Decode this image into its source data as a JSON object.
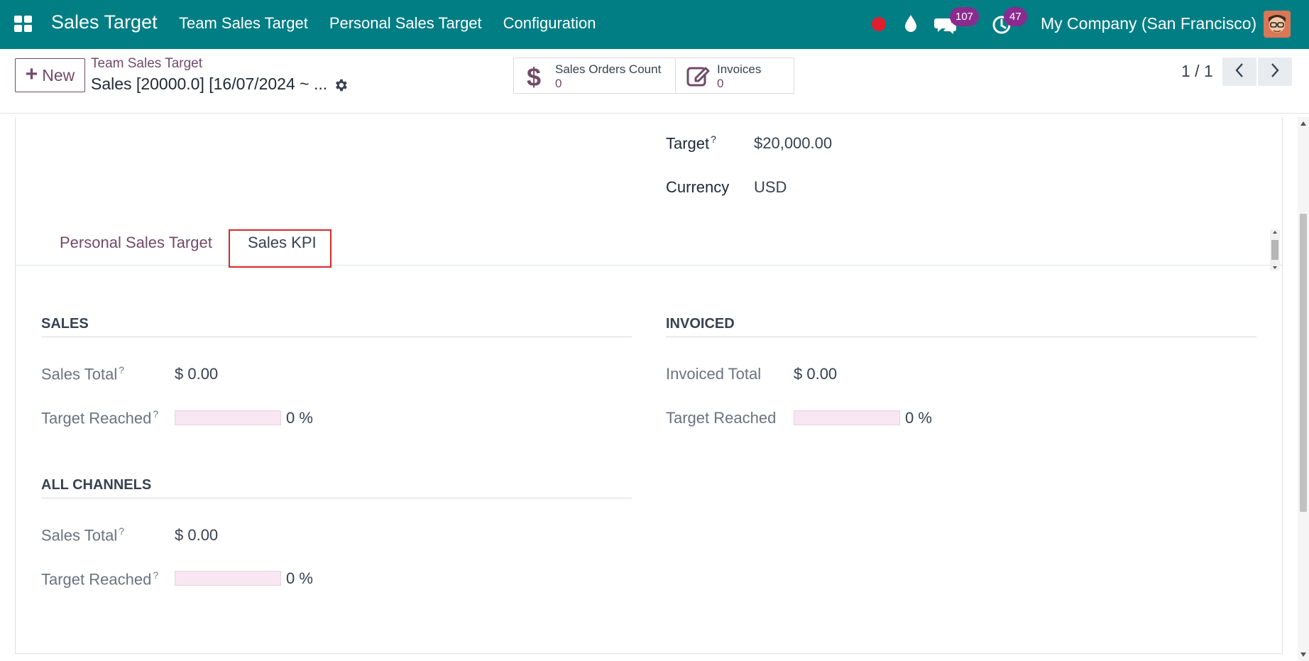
{
  "navbar": {
    "app_title": "Sales Target",
    "menu": [
      "Team Sales Target",
      "Personal Sales Target",
      "Configuration"
    ],
    "messages_badge": "107",
    "activities_badge": "47",
    "company": "My Company (San Francisco)"
  },
  "control_panel": {
    "new_label": "New",
    "breadcrumb": "Team Sales Target",
    "record_name": "Sales [20000.0] [16/07/2024 ~ ...",
    "smart_buttons": [
      {
        "label": "Sales Orders Count",
        "value": "0",
        "icon": "dollar-icon"
      },
      {
        "label": "Invoices",
        "value": "0",
        "icon": "edit-icon"
      }
    ],
    "pager": "1 / 1"
  },
  "form": {
    "target_label": "Target",
    "target_help": "?",
    "target_value": "$20,000.00",
    "currency_label": "Currency",
    "currency_value": "USD",
    "tabs": [
      "Personal Sales Target",
      "Sales KPI"
    ],
    "active_tab": "Sales KPI"
  },
  "kpi": {
    "sales": {
      "title": "SALES",
      "total_label": "Sales Total",
      "total_value": "$ 0.00",
      "reached_label": "Target Reached",
      "reached_value": "0 %",
      "reached_fraction": 0
    },
    "invoiced": {
      "title": "INVOICED",
      "total_label": "Invoiced Total",
      "total_value": "$ 0.00",
      "reached_label": "Target Reached",
      "reached_value": "0 %",
      "reached_fraction": 0
    },
    "all_channels": {
      "title": "ALL CHANNELS",
      "total_label": "Sales Total",
      "total_value": "$ 0.00",
      "reached_label": "Target Reached",
      "reached_value": "0 %",
      "reached_fraction": 0
    }
  },
  "colors": {
    "navbar": "#017e84",
    "brand": "#714b67",
    "highlight": "#d62828"
  }
}
